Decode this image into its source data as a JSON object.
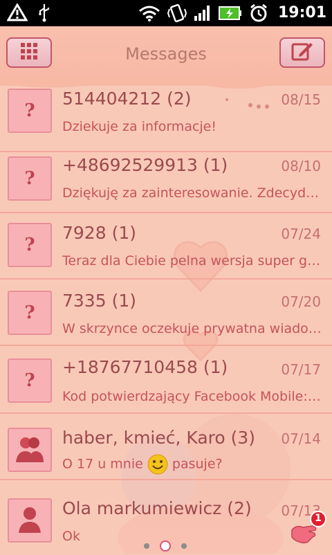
{
  "status_bar": {
    "time": "19:01",
    "left_icons": [
      "warning-icon",
      "usb-icon"
    ],
    "right_icons": [
      "wifi-icon",
      "vibrate-icon",
      "signal-icon",
      "battery-charging-icon",
      "alarm-icon"
    ]
  },
  "header": {
    "title": "Messages",
    "left_button_icon": "grid-icon",
    "right_button_icon": "compose-icon"
  },
  "conversations": [
    {
      "name": "514404212 (2)",
      "date": "08/15",
      "preview": "Dziekuje za informacje!",
      "avatar": "unknown-contact"
    },
    {
      "name": "+48692529913 (1)",
      "date": "08/10",
      "preview": "Dziękuję za zainteresowanie. Zdecydo…",
      "avatar": "unknown-contact"
    },
    {
      "name": "7928 (1)",
      "date": "07/24",
      "preview": "Teraz dla Ciebie pelna wersja super gry…",
      "avatar": "unknown-contact"
    },
    {
      "name": "7335 (1)",
      "date": "07/20",
      "preview": "W skrzynce oczekuje prywatna wiado…",
      "avatar": "unknown-contact"
    },
    {
      "name": "+18767710458 (1)",
      "date": "07/17",
      "preview": "Kod potwierdzający Facebook Mobile: …",
      "avatar": "unknown-contact"
    },
    {
      "name": "haber, kmieć, Karo (3)",
      "date": "07/14",
      "preview_before": "O 17 u mnie",
      "preview_after": "pasuje?",
      "avatar": "group-contact"
    },
    {
      "name": "Ola markumiewicz (2)",
      "date": "07/13",
      "preview": "Ok",
      "avatar": "single-contact"
    }
  ],
  "unread_badge": "1",
  "page_indicator": {
    "pages": 3,
    "current": 2
  },
  "colors": {
    "accent": "#c0434f",
    "background": "#f9c9b8"
  }
}
